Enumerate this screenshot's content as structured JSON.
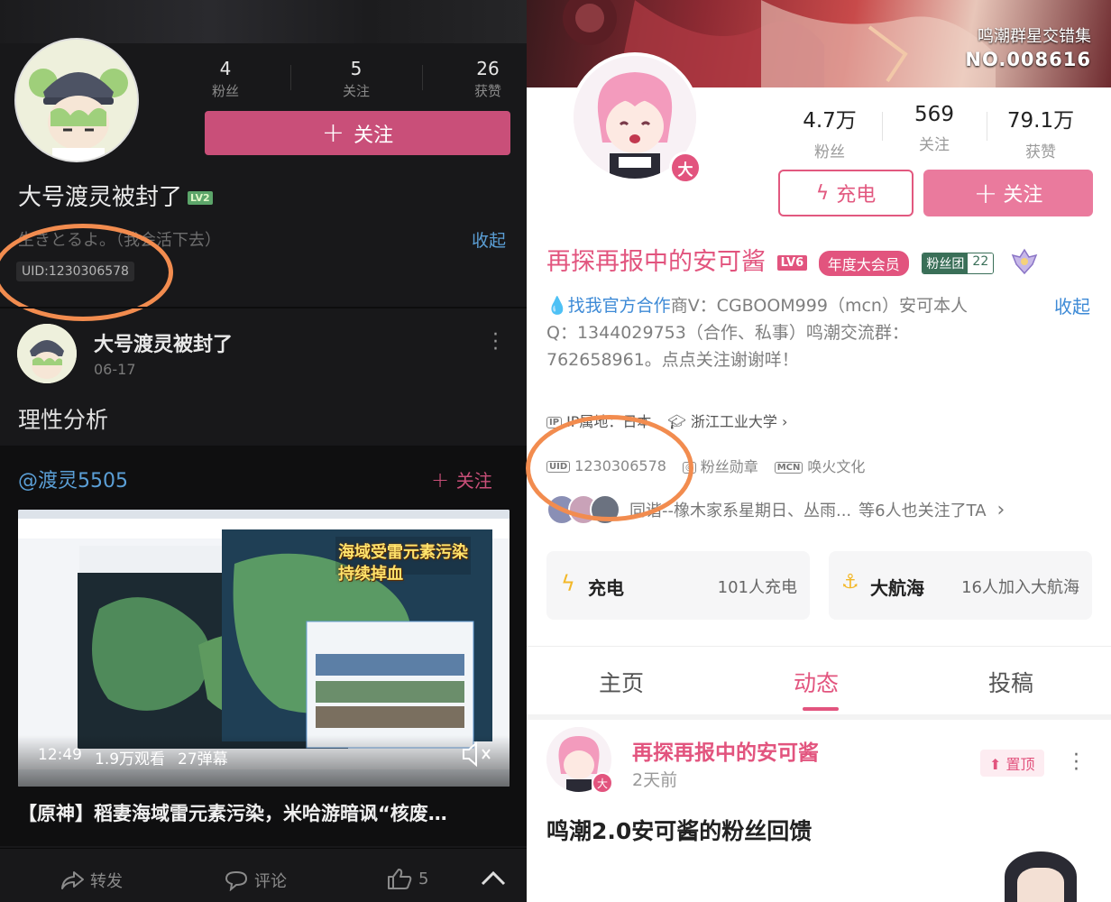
{
  "left": {
    "stats": [
      {
        "num": "4",
        "label": "粉丝"
      },
      {
        "num": "5",
        "label": "关注"
      },
      {
        "num": "26",
        "label": "获赞"
      }
    ],
    "follow_label": "关注",
    "username": "大号渡灵被封了",
    "level": "LV2",
    "bio": "生きとるよ。（我会活下去）",
    "collapse": "收起",
    "uid": "UID:1230306578",
    "post": {
      "author": "大号渡灵被封了",
      "date": "06-17",
      "text": "理性分析"
    },
    "repost": {
      "at_user": "@渡灵5505",
      "follow": "关注",
      "video_overlay_text": "海域受雷元素污染\n持续掉血",
      "duration": "12:49",
      "views": "1.9万观看",
      "danmaku": "27弹幕",
      "title": "【原神】稻妻海域雷元素污染，米哈游暗讽“核废…"
    },
    "actions": {
      "share": "转发",
      "comment": "评论",
      "likes": "5"
    }
  },
  "right": {
    "banner_title": "鸣潮群星交错集",
    "banner_no": "NO.008616",
    "avatar_badge": "大",
    "stats": [
      {
        "num": "4.7万",
        "label": "粉丝"
      },
      {
        "num": "569",
        "label": "关注"
      },
      {
        "num": "79.1万",
        "label": "获赞"
      }
    ],
    "charge_label": "充电",
    "follow_label": "关注",
    "username": "再探再报中的安可酱",
    "level": "LV6",
    "vip": "年度大会员",
    "fan_group": "粉丝团",
    "fan_group_level": "22",
    "desc_link": "找我官方合作",
    "desc_text": "商V：CGBOOM999（mcn）安可本人Q：1344029753（合作、私事）鸣潮交流群：762658961。点点关注谢谢咩！",
    "collapse": "收起",
    "ip": "IP属地：日本",
    "school": "浙江工业大学",
    "uid": "1230306578",
    "fan_medal": "粉丝勋章",
    "mcn": "唤火文化",
    "mutual_names": "同谐--橡木家系星期日、丛雨...",
    "mutual_suffix": "等6人也关注了TA",
    "card_charge_title": "充电",
    "card_charge_sub": "101人充电",
    "card_fleet_title": "大航海",
    "card_fleet_sub": "16人加入大航海",
    "tabs": [
      "主页",
      "动态",
      "投稿"
    ],
    "post": {
      "author": "再探再报中的安可酱",
      "date": "2天前",
      "pinned": "置顶",
      "title": "鸣潮2.0安可酱的粉丝回馈"
    }
  },
  "colors": {
    "pink": "#e2547e",
    "link_blue": "#3d8ad6",
    "highlight_orange": "#f28c4f"
  }
}
